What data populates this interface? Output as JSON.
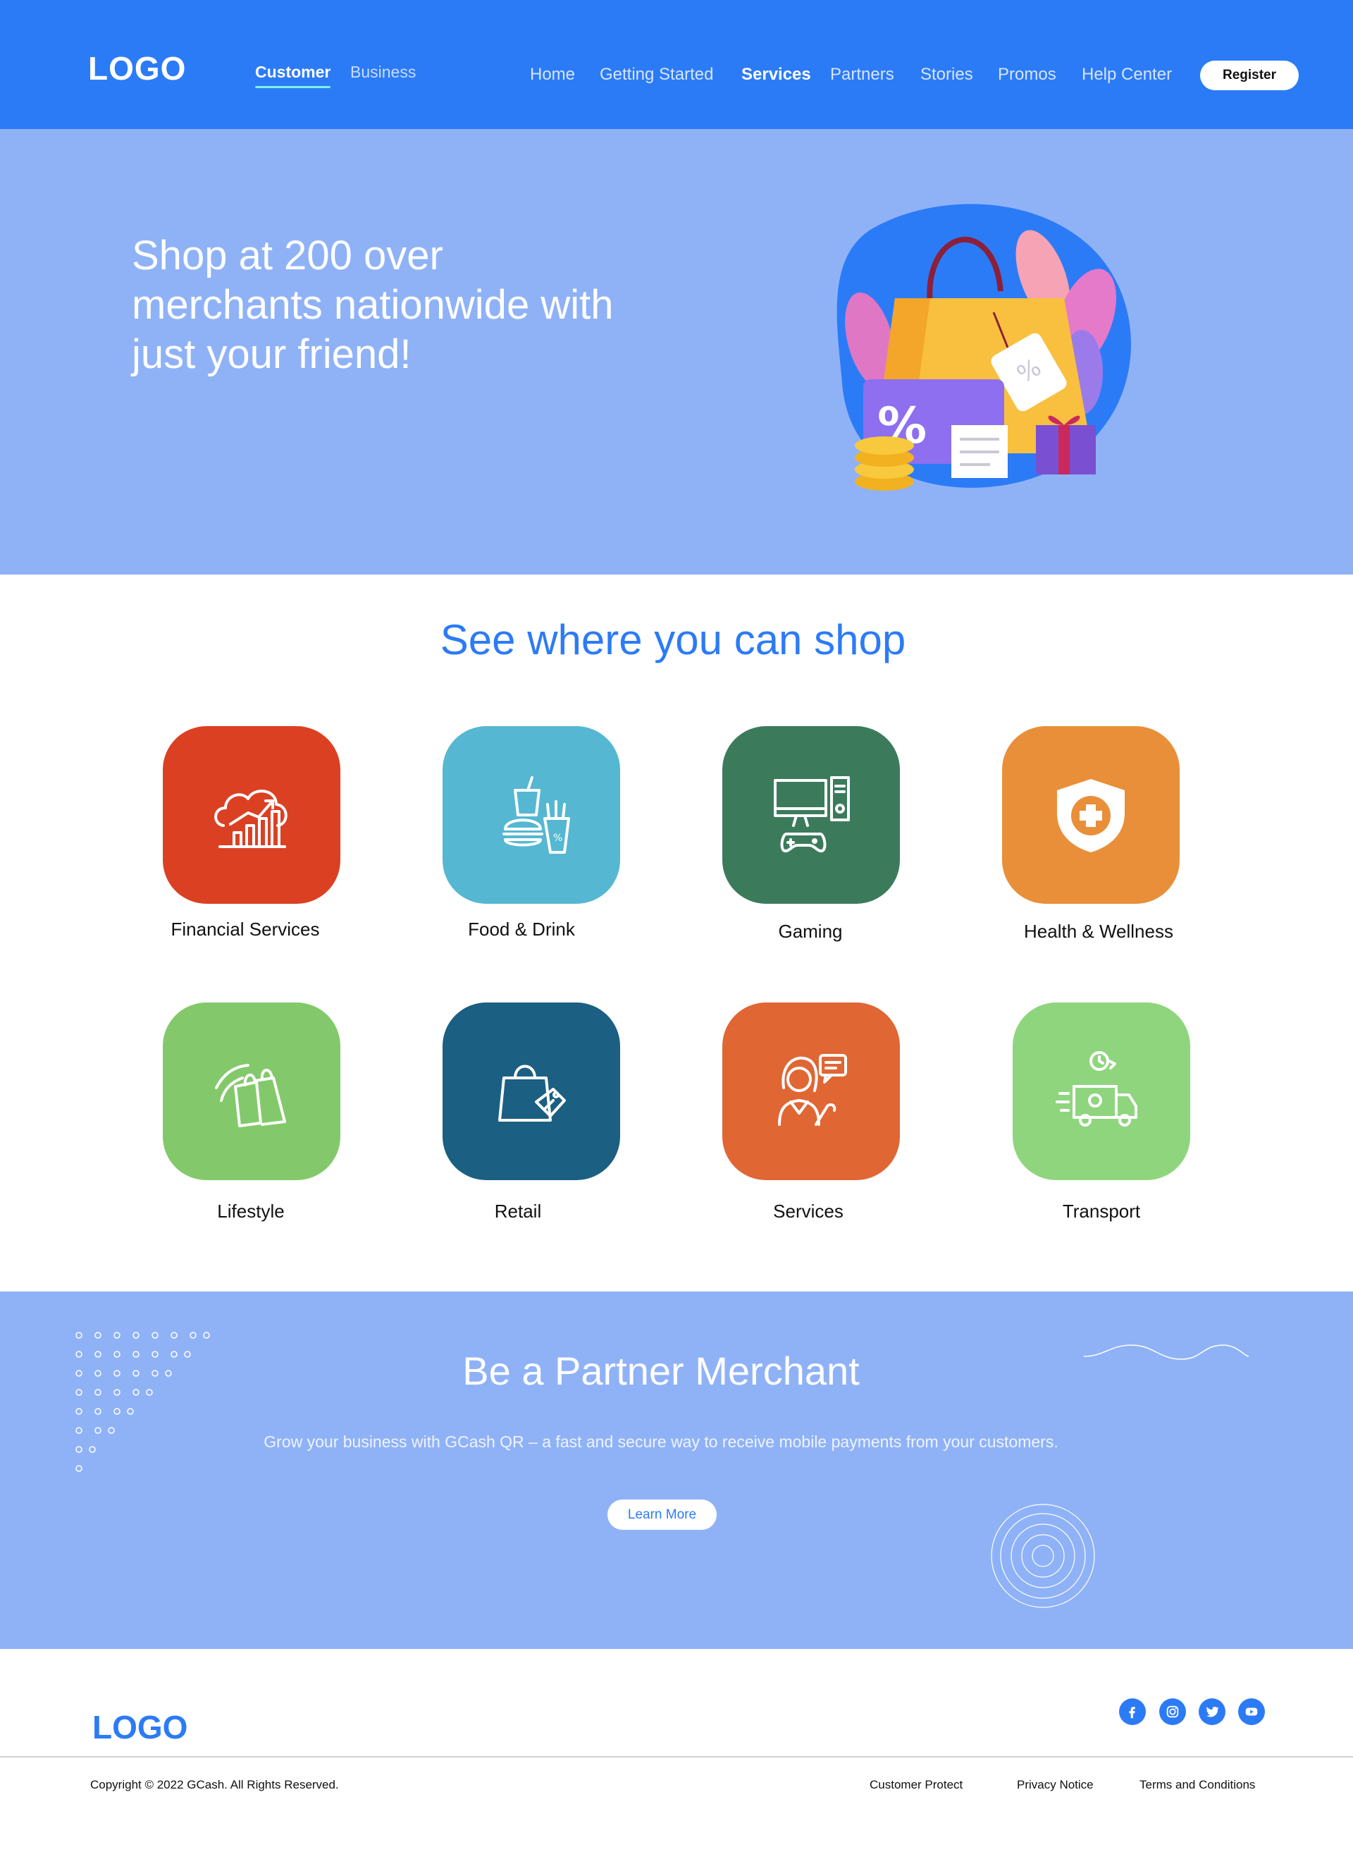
{
  "header": {
    "logo": "LOGO",
    "segments": {
      "customer": "Customer",
      "business": "Business"
    },
    "nav": {
      "home": "Home",
      "getting_started": "Getting Started",
      "services": "Services",
      "partners": "Partners",
      "stories": "Stories",
      "promos": "Promos",
      "help_center": "Help Center"
    },
    "register": "Register"
  },
  "hero": {
    "title": "Shop at 200 over merchants nationwide with just your friend!",
    "illustration": "shopping-bag-illustration"
  },
  "categories": {
    "title": "See where you can shop",
    "items": [
      {
        "label": "Financial Services",
        "icon": "financial-growth-icon",
        "color": "#db4023"
      },
      {
        "label": "Food & Drink",
        "icon": "fast-food-icon",
        "color": "#55b7d2"
      },
      {
        "label": "Gaming",
        "icon": "gaming-computer-icon",
        "color": "#3b7b5c"
      },
      {
        "label": "Health & Wellness",
        "icon": "health-shield-icon",
        "color": "#e98f39"
      },
      {
        "label": "Lifestyle",
        "icon": "shopping-bags-icon",
        "color": "#83c96b"
      },
      {
        "label": "Retail",
        "icon": "retail-bag-tag-icon",
        "color": "#1b5f83"
      },
      {
        "label": "Services",
        "icon": "customer-service-icon",
        "color": "#e06634"
      },
      {
        "label": "Transport",
        "icon": "delivery-truck-icon",
        "color": "#8fd57e"
      }
    ]
  },
  "partner": {
    "title": "Be a Partner Merchant",
    "description": "Grow your business with GCash QR – a fast and secure way to receive mobile payments from your customers.",
    "cta": "Learn More"
  },
  "footer": {
    "logo": "LOGO",
    "social": [
      "facebook-icon",
      "instagram-icon",
      "twitter-icon",
      "youtube-icon"
    ],
    "copyright": "Copyright © 2022 GCash. All Rights Reserved.",
    "links": {
      "customer_protect": "Customer Protect",
      "privacy_notice": "Privacy Notice",
      "terms": "Terms and Conditions"
    }
  },
  "colors": {
    "brand": "#2c7bf6",
    "hero_bg": "#8fb2f7",
    "accent_underline": "#7ff0e2"
  }
}
